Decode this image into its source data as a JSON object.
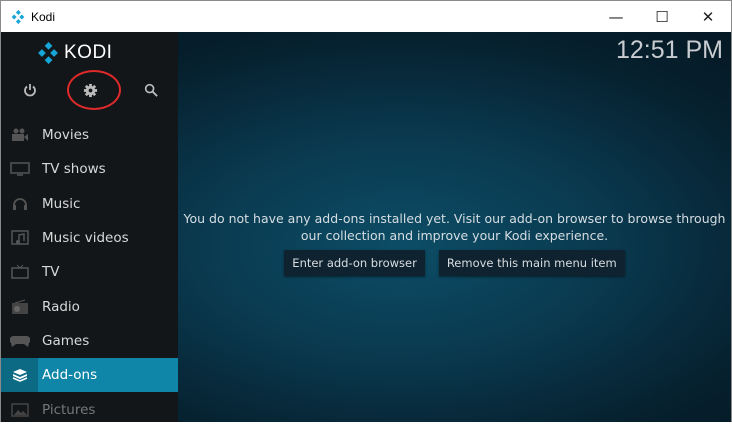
{
  "window": {
    "title": "Kodi",
    "minimize": "—",
    "maximize": "☐",
    "close": "✕"
  },
  "logo": "KODI",
  "clock": "12:51 PM",
  "menu": [
    {
      "label": "Movies",
      "icon": "movie-camera-icon"
    },
    {
      "label": "TV shows",
      "icon": "monitor-icon"
    },
    {
      "label": "Music",
      "icon": "headphones-icon"
    },
    {
      "label": "Music videos",
      "icon": "music-video-icon"
    },
    {
      "label": "TV",
      "icon": "tv-icon"
    },
    {
      "label": "Radio",
      "icon": "radio-icon"
    },
    {
      "label": "Games",
      "icon": "gamepad-icon"
    },
    {
      "label": "Add-ons",
      "icon": "addons-box-icon",
      "active": true
    },
    {
      "label": "Pictures",
      "icon": "pictures-icon"
    }
  ],
  "main": {
    "message": "You do not have any add-ons installed yet. Visit our add-on browser to browse through our collection and improve your Kodi experience.",
    "enter_button": "Enter add-on browser",
    "remove_button": "Remove this main menu item"
  },
  "colors": {
    "accent": "#0f86a7",
    "annotation": "#e02a2a"
  }
}
